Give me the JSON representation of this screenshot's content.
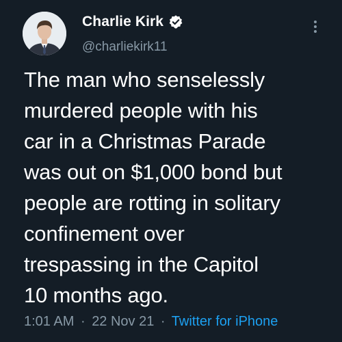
{
  "user": {
    "display_name": "Charlie Kirk",
    "handle": "@charliekirk11",
    "verified": true
  },
  "tweet": {
    "text": "The man who senselessly\nmurdered people with his\ncar in a Christmas Parade\nwas out on $1,000 bond but\npeople are rotting in solitary\nconfinement over\ntrespassing in the Capitol\n10 months ago.",
    "time": "1:01 AM",
    "separator": "·",
    "date": "22 Nov 21",
    "source": "Twitter for iPhone"
  },
  "colors": {
    "background": "#141d26",
    "text": "#ffffff",
    "secondary": "#8899a6",
    "link": "#1da1f2"
  },
  "icons": {
    "verified": "verified-badge-icon",
    "more": "more-vertical-icon"
  }
}
